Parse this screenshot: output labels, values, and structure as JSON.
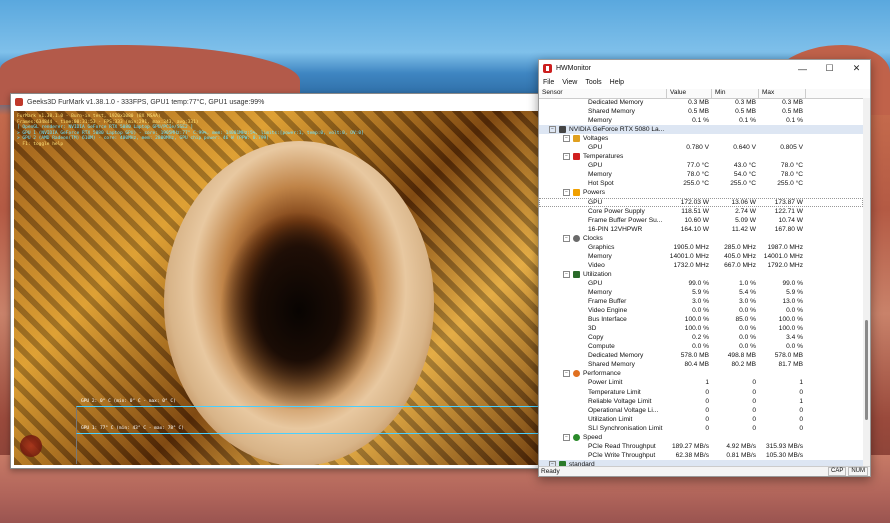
{
  "furmark": {
    "title": "Geeks3D FurMark v1.38.1.0 - 333FPS, GPU1 temp:77°C, GPU1 usage:99%",
    "osd_lines": [
      "FurMark v1.38.1.0 - Burn-in test, 1920x1080 (8X MSAA)",
      "Frames:634844 - time:00:31:53 - FPS:333 (min:291, max:343, avg:331)",
      "[ OpenGL renderer: NVIDIA GeForce RTX 5080 Laptop GPU/PCIe/SSE2 ]",
      "> GPU 1 (NVIDIA GeForce RTX 5080 Laptop GPU) - core: 1905MHz:77° C:99%, mem: 14001MHz:5%, limits:[power:1, temp:0, volt:0, OV:0]",
      "> GPU 2 (AMD Radeon(TM) 610M) - core: 400MHz, mem: 2800MHz, GPU chip power: 46 W (PPW: 0.799)",
      "- F1: toggle help"
    ],
    "graph1_label": "GPU 2: 0° C (min: 0° C - max: 0° C)",
    "graph2_label": "GPU 1: 77° C (min: 43° C - max: 78° C)"
  },
  "hwmonitor": {
    "title": "HWMonitor",
    "menu": [
      "File",
      "View",
      "Tools",
      "Help"
    ],
    "columns": {
      "sensor": "Sensor",
      "value": "Value",
      "min": "Min",
      "max": "Max"
    },
    "rows": [
      {
        "type": "item",
        "name": "Dedicated Memory",
        "value": "0.3 MB",
        "min": "0.3 MB",
        "max": "0.3 MB"
      },
      {
        "type": "item",
        "name": "Shared Memory",
        "value": "0.5 MB",
        "min": "0.5 MB",
        "max": "0.5 MB"
      },
      {
        "type": "item",
        "name": "Memory",
        "value": "0.1 %",
        "min": "0.1 %",
        "max": "0.1 %"
      },
      {
        "type": "device",
        "name": "NVIDIA GeForce RTX 5080 La...",
        "icon": "gpu-card-icon"
      },
      {
        "type": "group",
        "name": "Voltages",
        "icon": "voltage-icon"
      },
      {
        "type": "item",
        "name": "GPU",
        "value": "0.780 V",
        "min": "0.640 V",
        "max": "0.805 V"
      },
      {
        "type": "group",
        "name": "Temperatures",
        "icon": "thermometer-icon"
      },
      {
        "type": "item",
        "name": "GPU",
        "value": "77.0 °C",
        "min": "43.0 °C",
        "max": "78.0 °C"
      },
      {
        "type": "item",
        "name": "Memory",
        "value": "78.0 °C",
        "min": "54.0 °C",
        "max": "78.0 °C"
      },
      {
        "type": "item",
        "name": "Hot Spot",
        "value": "255.0 °C",
        "min": "255.0 °C",
        "max": "255.0 °C"
      },
      {
        "type": "group",
        "name": "Powers",
        "icon": "power-icon"
      },
      {
        "type": "item",
        "name": "GPU",
        "value": "172.03 W",
        "min": "13.06 W",
        "max": "173.87 W",
        "highlight": true
      },
      {
        "type": "item",
        "name": "Core Power Supply",
        "value": "118.51 W",
        "min": "2.74 W",
        "max": "122.71 W"
      },
      {
        "type": "item",
        "name": "Frame Buffer Power Su...",
        "value": "10.60 W",
        "min": "5.09 W",
        "max": "10.74 W"
      },
      {
        "type": "item",
        "name": "16-PIN 12VHPWR",
        "value": "164.10 W",
        "min": "11.42 W",
        "max": "167.80 W"
      },
      {
        "type": "group",
        "name": "Clocks",
        "icon": "clock-icon"
      },
      {
        "type": "item",
        "name": "Graphics",
        "value": "1905.0 MHz",
        "min": "285.0 MHz",
        "max": "1987.0 MHz"
      },
      {
        "type": "item",
        "name": "Memory",
        "value": "14001.0 MHz",
        "min": "405.0 MHz",
        "max": "14001.0 MHz"
      },
      {
        "type": "item",
        "name": "Video",
        "value": "1732.0 MHz",
        "min": "667.0 MHz",
        "max": "1792.0 MHz"
      },
      {
        "type": "group",
        "name": "Utilization",
        "icon": "utilization-icon"
      },
      {
        "type": "item",
        "name": "GPU",
        "value": "99.0 %",
        "min": "1.0 %",
        "max": "99.0 %"
      },
      {
        "type": "item",
        "name": "Memory",
        "value": "5.9 %",
        "min": "5.4 %",
        "max": "5.9 %"
      },
      {
        "type": "item",
        "name": "Frame Buffer",
        "value": "3.0 %",
        "min": "3.0 %",
        "max": "13.0 %"
      },
      {
        "type": "item",
        "name": "Video Engine",
        "value": "0.0 %",
        "min": "0.0 %",
        "max": "0.0 %"
      },
      {
        "type": "item",
        "name": "Bus Interface",
        "value": "100.0 %",
        "min": "85.0 %",
        "max": "100.0 %"
      },
      {
        "type": "item",
        "name": "3D",
        "value": "100.0 %",
        "min": "0.0 %",
        "max": "100.0 %"
      },
      {
        "type": "item",
        "name": "Copy",
        "value": "0.2 %",
        "min": "0.0 %",
        "max": "3.4 %"
      },
      {
        "type": "item",
        "name": "Compute",
        "value": "0.0 %",
        "min": "0.0 %",
        "max": "0.0 %"
      },
      {
        "type": "item",
        "name": "Dedicated Memory",
        "value": "578.0 MB",
        "min": "498.8 MB",
        "max": "578.0 MB"
      },
      {
        "type": "item",
        "name": "Shared Memory",
        "value": "80.4 MB",
        "min": "80.2 MB",
        "max": "81.7 MB"
      },
      {
        "type": "group",
        "name": "Performance",
        "icon": "performance-icon"
      },
      {
        "type": "item",
        "name": "Power Limit",
        "value": "1",
        "min": "0",
        "max": "1"
      },
      {
        "type": "item",
        "name": "Temperature Limit",
        "value": "0",
        "min": "0",
        "max": "0"
      },
      {
        "type": "item",
        "name": "Reliable Voltage Limit",
        "value": "0",
        "min": "0",
        "max": "1"
      },
      {
        "type": "item",
        "name": "Operational Voltage Li...",
        "value": "0",
        "min": "0",
        "max": "0"
      },
      {
        "type": "item",
        "name": "Utilization Limit",
        "value": "0",
        "min": "0",
        "max": "0"
      },
      {
        "type": "item",
        "name": "SLI Synchronisation Limit",
        "value": "0",
        "min": "0",
        "max": "0"
      },
      {
        "type": "group",
        "name": "Speed",
        "icon": "speed-icon"
      },
      {
        "type": "item",
        "name": "PCIe Read Throughput",
        "value": "189.27 MB/s",
        "min": "4.92 MB/s",
        "max": "315.93 MB/s"
      },
      {
        "type": "item",
        "name": "PCIe Write Throughput",
        "value": "62.38 MB/s",
        "min": "0.81 MB/s",
        "max": "105.30 MB/s"
      },
      {
        "type": "device",
        "name": "standard",
        "icon": "computer-icon"
      }
    ],
    "status": "Ready",
    "indicators": [
      "CAP",
      "NUM"
    ]
  }
}
